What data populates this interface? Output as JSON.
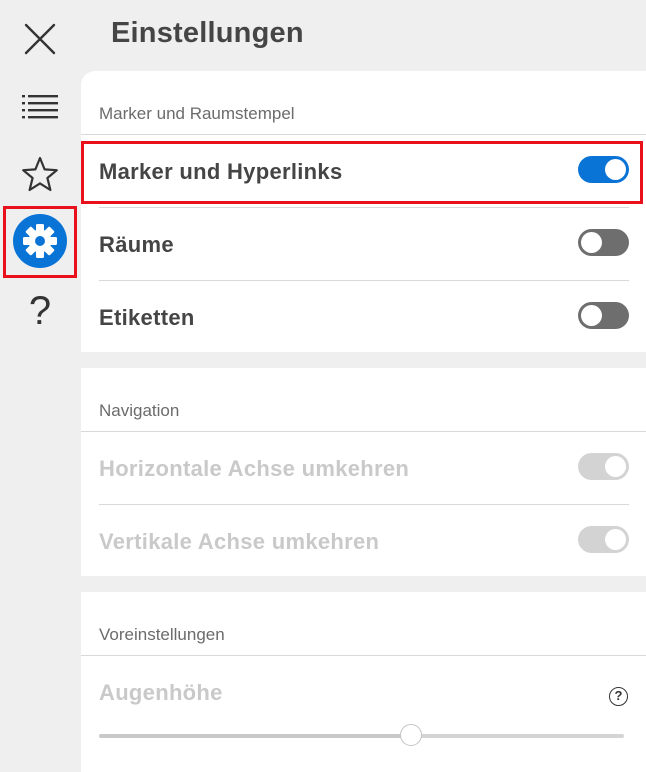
{
  "page": {
    "title": "Einstellungen"
  },
  "rail": {
    "items": [
      {
        "id": "close",
        "icon": "close-icon"
      },
      {
        "id": "list",
        "icon": "list-icon"
      },
      {
        "id": "favorites",
        "icon": "star-icon"
      },
      {
        "id": "settings",
        "icon": "gear-icon",
        "active": true
      },
      {
        "id": "help",
        "icon": "question-mark-icon",
        "glyph": "?"
      }
    ]
  },
  "sections": {
    "markers": {
      "label": "Marker und Raumstempel",
      "rows": [
        {
          "label": "Marker und Hyperlinks",
          "state": "on"
        },
        {
          "label": "Räume",
          "state": "off"
        },
        {
          "label": "Etiketten",
          "state": "off"
        }
      ]
    },
    "navigation": {
      "label": "Navigation",
      "rows": [
        {
          "label": "Horizontale Achse umkehren",
          "state": "disabled"
        },
        {
          "label": "Vertikale Achse umkehren",
          "state": "disabled"
        }
      ]
    },
    "presets": {
      "label": "Voreinstellungen",
      "eye_height": {
        "label": "Augenhöhe",
        "help_glyph": "?",
        "value_fraction": 0.595
      }
    }
  },
  "colors": {
    "accent": "#0a74d6",
    "highlight": "#e8101a",
    "toggle_off": "#6e6e6e",
    "disabled": "#c9c9c9"
  }
}
